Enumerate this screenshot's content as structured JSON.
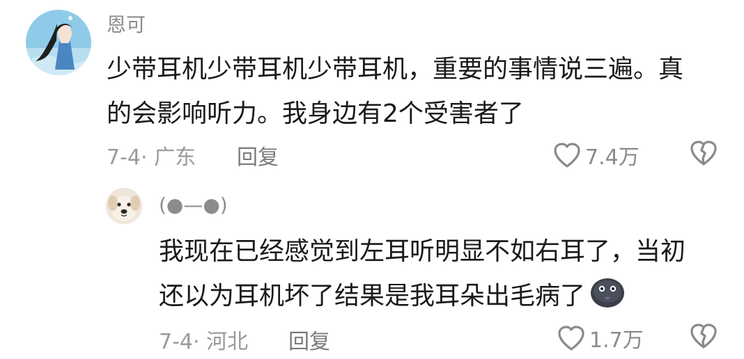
{
  "comments": [
    {
      "username": "恩可",
      "content_line1": "少带耳机少带耳机少带耳机，重要的事情说三遍。真",
      "content_line2": "的会影响听力。我身边有2个受害者了",
      "date_location": "7-4· 广东",
      "reply_label": "回复",
      "like_count": "7.4万",
      "avatar_icon": "girl-with-long-hair-avatar"
    },
    {
      "username": "(●—●)",
      "content_line1": "我现在已经感觉到左耳听明显不如右耳了，当初",
      "content_line2": "还以为耳机坏了结果是我耳朵出毛病了",
      "emoji": "dark-face-emoji",
      "date_location": "7-4· 河北",
      "reply_label": "回复",
      "like_count": "1.7万",
      "avatar_icon": "dog-face-avatar"
    }
  ],
  "colors": {
    "primary_text": "#1a1a1a",
    "secondary_text": "#8c8c8c",
    "icon": "#8a8a8a"
  }
}
